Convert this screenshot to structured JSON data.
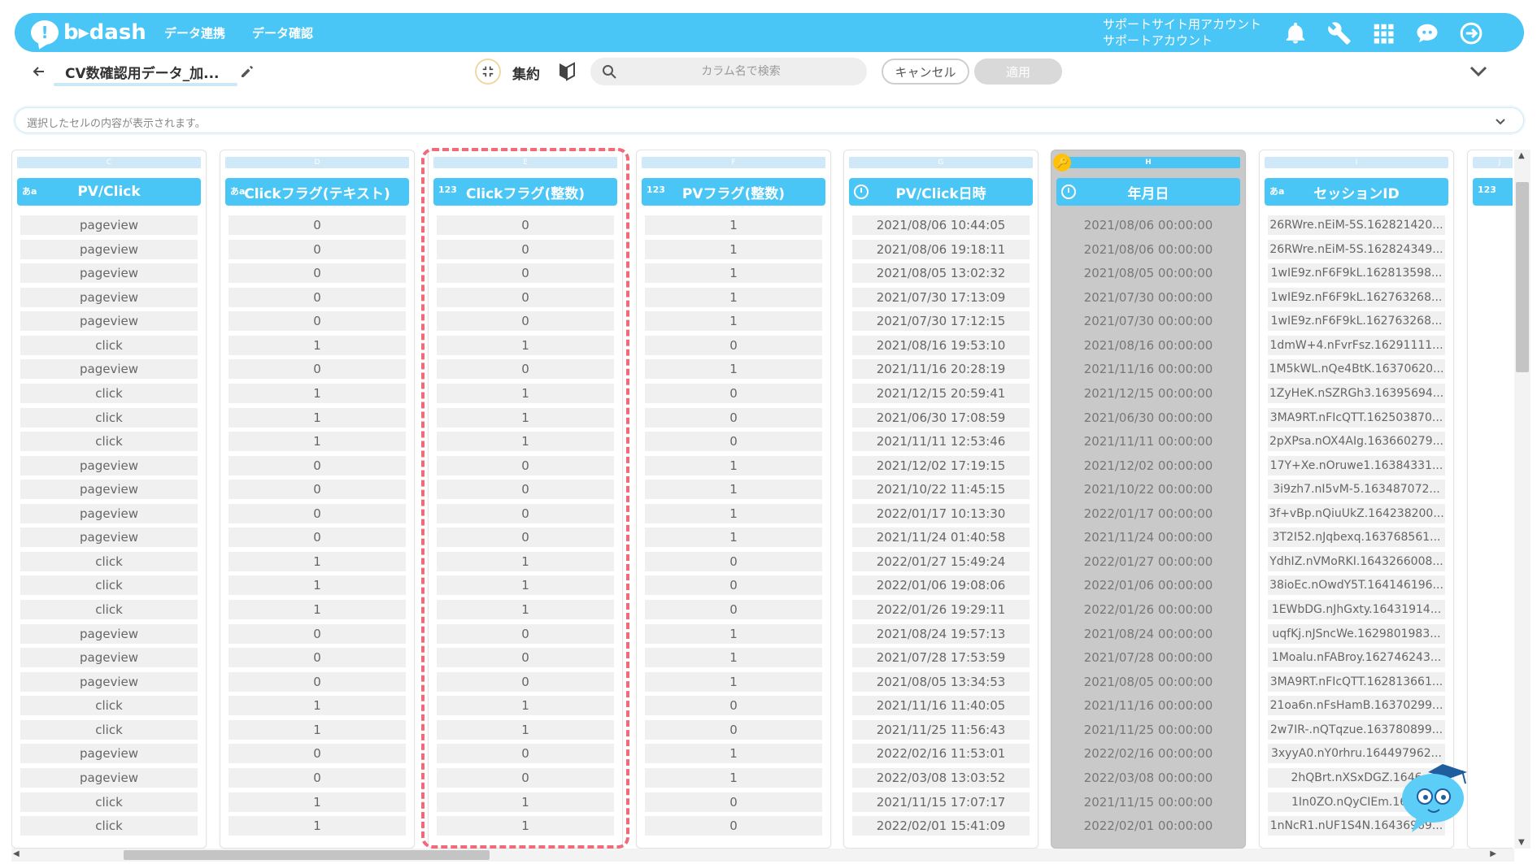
{
  "topbar": {
    "logo_text": "b▸dash",
    "nav": [
      "データ連携",
      "データ確認"
    ],
    "account_line1": "サポートサイト用アカウント",
    "account_line2": "サポートアカウント"
  },
  "toolbar": {
    "dataset_title": "CV数確認用データ_加...",
    "aggregate_label": "集約",
    "search_placeholder": "カラム名で検索",
    "cancel_label": "キャンセル",
    "apply_label": "適用"
  },
  "cellbar": {
    "placeholder": "選択したセルの内容が表示されます。"
  },
  "columns": [
    {
      "letter": "C",
      "type": "あa",
      "title": "PV/Click",
      "cells": [
        "pageview",
        "pageview",
        "pageview",
        "pageview",
        "pageview",
        "click",
        "pageview",
        "click",
        "click",
        "click",
        "pageview",
        "pageview",
        "pageview",
        "pageview",
        "click",
        "click",
        "click",
        "pageview",
        "pageview",
        "pageview",
        "click",
        "click",
        "pageview",
        "pageview",
        "click",
        "click"
      ]
    },
    {
      "letter": "D",
      "type": "あa",
      "title": "Clickフラグ(テキスト)",
      "cells": [
        "0",
        "0",
        "0",
        "0",
        "0",
        "1",
        "0",
        "1",
        "1",
        "1",
        "0",
        "0",
        "0",
        "0",
        "1",
        "1",
        "1",
        "0",
        "0",
        "0",
        "1",
        "1",
        "0",
        "0",
        "1",
        "1"
      ]
    },
    {
      "letter": "E",
      "type": "123",
      "title": "Clickフラグ(整数)",
      "cells": [
        "0",
        "0",
        "0",
        "0",
        "0",
        "1",
        "0",
        "1",
        "1",
        "1",
        "0",
        "0",
        "0",
        "0",
        "1",
        "1",
        "1",
        "0",
        "0",
        "0",
        "1",
        "1",
        "0",
        "0",
        "1",
        "1"
      ]
    },
    {
      "letter": "F",
      "type": "123",
      "title": "PVフラグ(整数)",
      "cells": [
        "1",
        "1",
        "1",
        "1",
        "1",
        "0",
        "1",
        "0",
        "0",
        "0",
        "1",
        "1",
        "1",
        "1",
        "0",
        "0",
        "0",
        "1",
        "1",
        "1",
        "0",
        "0",
        "1",
        "1",
        "0",
        "0"
      ]
    },
    {
      "letter": "G",
      "type": "clock",
      "title": "PV/Click日時",
      "cells": [
        "2021/08/06 10:44:05",
        "2021/08/06 19:18:11",
        "2021/08/05 13:02:32",
        "2021/07/30 17:13:09",
        "2021/07/30 17:12:15",
        "2021/08/16 19:53:10",
        "2021/11/16 20:28:19",
        "2021/12/15 20:59:41",
        "2021/06/30 17:08:59",
        "2021/11/11 12:53:46",
        "2021/12/02 17:19:15",
        "2021/10/22 11:45:15",
        "2022/01/17 10:13:30",
        "2021/11/24 01:40:58",
        "2022/01/27 15:49:24",
        "2022/01/06 19:08:06",
        "2022/01/26 19:29:11",
        "2021/08/24 19:57:13",
        "2021/07/28 17:53:59",
        "2021/08/05 13:34:53",
        "2021/11/16 11:40:05",
        "2021/11/25 11:56:43",
        "2022/02/16 11:53:01",
        "2022/03/08 13:03:52",
        "2021/11/15 17:07:17",
        "2022/02/01 15:41:09"
      ]
    },
    {
      "letter": "H",
      "type": "clock",
      "title": "年月日",
      "key": true,
      "cells": [
        "2021/08/06 00:00:00",
        "2021/08/06 00:00:00",
        "2021/08/05 00:00:00",
        "2021/07/30 00:00:00",
        "2021/07/30 00:00:00",
        "2021/08/16 00:00:00",
        "2021/11/16 00:00:00",
        "2021/12/15 00:00:00",
        "2021/06/30 00:00:00",
        "2021/11/11 00:00:00",
        "2021/12/02 00:00:00",
        "2021/10/22 00:00:00",
        "2022/01/17 00:00:00",
        "2021/11/24 00:00:00",
        "2022/01/27 00:00:00",
        "2022/01/06 00:00:00",
        "2022/01/26 00:00:00",
        "2021/08/24 00:00:00",
        "2021/07/28 00:00:00",
        "2021/08/05 00:00:00",
        "2021/11/16 00:00:00",
        "2021/11/25 00:00:00",
        "2022/02/16 00:00:00",
        "2022/03/08 00:00:00",
        "2021/11/15 00:00:00",
        "2022/02/01 00:00:00"
      ]
    },
    {
      "letter": "I",
      "type": "あa",
      "title": "セッションID",
      "cells": [
        "26RWre.nEiM-5S.162821420...",
        "26RWre.nEiM-5S.162824349...",
        "1wIE9z.nF6F9kL.162813598...",
        "1wIE9z.nF6F9kL.162763268...",
        "1wIE9z.nF6F9kL.162763268...",
        "1dmW+4.nFvrFsz.16291111...",
        "1M5kWL.nQe4BtK.16370620...",
        "1ZyHeK.nSZRGh3.16395694...",
        "3MA9RT.nFIcQTT.162503870...",
        "2pXPsa.nOX4AIg.163660279...",
        "17Y+Xe.nOruwe1.16384331...",
        "3i9zh7.nI5vM-5.163487072...",
        "3f+vBp.nQiuUkZ.164238200...",
        "3T2I52.nJqbexq.163768561...",
        "YdhIZ.nVMoRKI.1643266008...",
        "38ioEc.nOwdY5T.164146196...",
        "1EWbDG.nJhGxty.16431914...",
        "uqfKj.nJSncWe.1629801983...",
        "1Moalu.nFABroy.162746243...",
        "3MA9RT.nFIcQTT.162813661...",
        "21oa6n.nFsHamB.16370299...",
        "2w7IR-.nQTqzue.163780899...",
        "3xyyA0.nY0rhru.164497962...",
        "2hQBrt.nXSxDGZ.1646",
        "1In0ZO.nQyCIEm.1636",
        "1nNcR1.nUF1S4N.16436969..."
      ]
    },
    {
      "letter": "J",
      "type": "123",
      "title": "",
      "cells": []
    }
  ]
}
